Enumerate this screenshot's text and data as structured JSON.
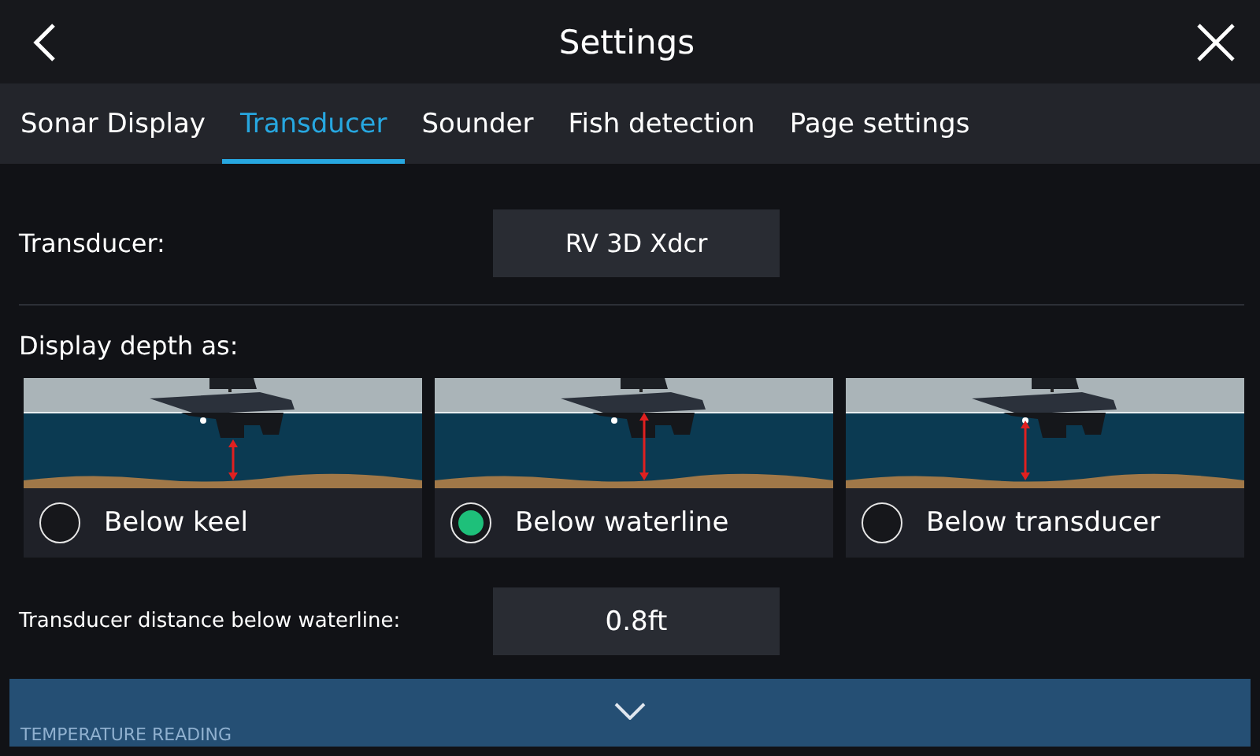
{
  "header": {
    "title": "Settings"
  },
  "tabs": [
    {
      "label": "Sonar Display",
      "selected": false
    },
    {
      "label": "Transducer",
      "selected": true
    },
    {
      "label": "Sounder",
      "selected": false
    },
    {
      "label": "Fish detection",
      "selected": false
    },
    {
      "label": "Page settings",
      "selected": false
    }
  ],
  "transducer": {
    "label": "Transducer:",
    "value": "RV 3D Xdcr"
  },
  "depth": {
    "label": "Display depth as:",
    "options": [
      {
        "kind": "keel",
        "label": "Below keel",
        "selected": false
      },
      {
        "kind": "waterline",
        "label": "Below waterline",
        "selected": true
      },
      {
        "kind": "transducer",
        "label": "Below transducer",
        "selected": false
      }
    ]
  },
  "offset": {
    "label": "Transducer distance below waterline:",
    "value": "0.8ft"
  },
  "next_section": {
    "label": "TEMPERATURE READING"
  }
}
